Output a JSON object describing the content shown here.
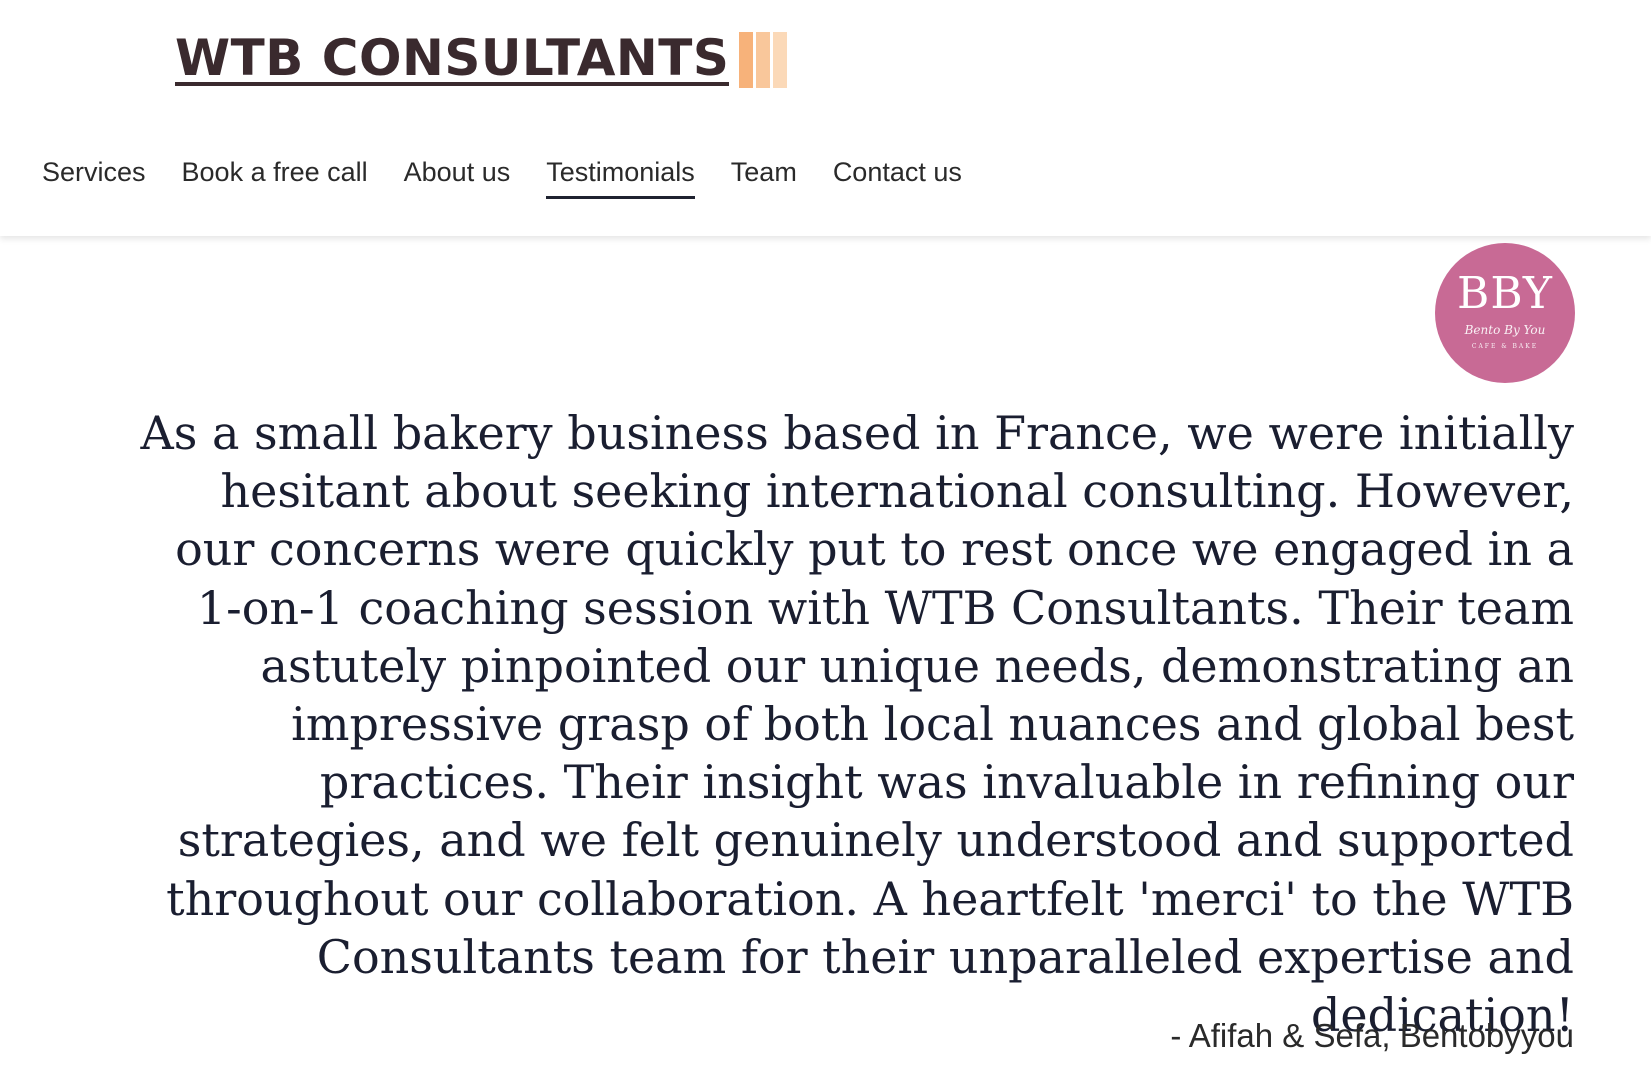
{
  "header": {
    "logo_text": "WTB CONSULTANTS",
    "logo_bar_colors": [
      "#f7b27a",
      "#f9c79b",
      "#fbd9b8"
    ]
  },
  "nav": {
    "items": [
      {
        "label": "Services",
        "active": false
      },
      {
        "label": "Book a free call",
        "active": false
      },
      {
        "label": "About us",
        "active": false
      },
      {
        "label": "Testimonials",
        "active": true
      },
      {
        "label": "Team",
        "active": false
      },
      {
        "label": "Contact us",
        "active": false
      }
    ]
  },
  "testimonial": {
    "badge": {
      "initials": "BBY",
      "script": "Bento By You",
      "sub": "CAFE & BAKE",
      "color": "#c86a95"
    },
    "quote": "As a small bakery business based in France, we were initially hesitant about seeking international consulting. However, our concerns were quickly put to rest once we engaged in a 1-on-1 coaching session with WTB Consultants. Their team astutely pinpointed our unique needs, demonstrating an impressive grasp of both local nuances and global best practices. Their insight was invaluable in refining our strategies, and we felt genuinely understood and supported throughout our collaboration. A heartfelt 'merci' to the WTB Consultants team for their unparalleled expertise and dedication!",
    "attribution": "- Afifah & Sefa, Bentobyyou"
  }
}
